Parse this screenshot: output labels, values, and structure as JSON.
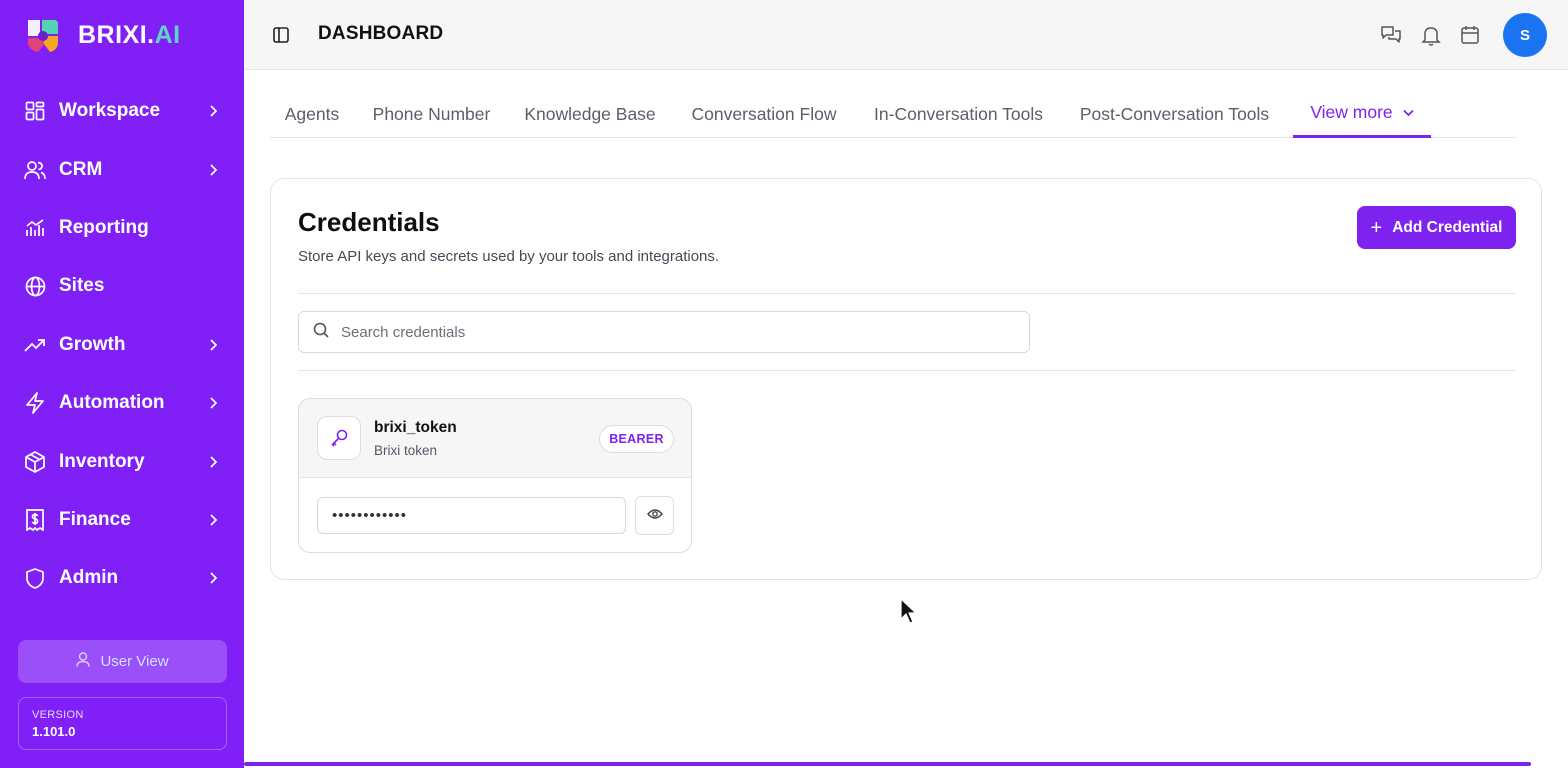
{
  "app": {
    "logo_main": "BRIXI.",
    "logo_accent": "AI"
  },
  "sidebar": {
    "items": [
      {
        "label": "Workspace",
        "icon": "grid-icon",
        "has_chevron": true
      },
      {
        "label": "CRM",
        "icon": "users-icon",
        "has_chevron": true
      },
      {
        "label": "Reporting",
        "icon": "chart-icon",
        "has_chevron": false
      },
      {
        "label": "Sites",
        "icon": "globe-icon",
        "has_chevron": false
      },
      {
        "label": "Growth",
        "icon": "trend-icon",
        "has_chevron": true
      },
      {
        "label": "Automation",
        "icon": "bolt-icon",
        "has_chevron": true
      },
      {
        "label": "Inventory",
        "icon": "box-icon",
        "has_chevron": true
      },
      {
        "label": "Finance",
        "icon": "receipt-icon",
        "has_chevron": true
      },
      {
        "label": "Admin",
        "icon": "shield-icon",
        "has_chevron": true
      }
    ],
    "user_view_label": "User View",
    "version_label": "VERSION",
    "version_number": "1.101.0"
  },
  "header": {
    "title": "DASHBOARD",
    "avatar_initial": "S"
  },
  "tabs": [
    {
      "label": "Agents",
      "active": false
    },
    {
      "label": "Phone Number",
      "active": false
    },
    {
      "label": "Knowledge Base",
      "active": false
    },
    {
      "label": "Conversation Flow",
      "active": false
    },
    {
      "label": "In-Conversation Tools",
      "active": false
    },
    {
      "label": "Post-Conversation Tools",
      "active": false
    },
    {
      "label": "View more",
      "active": true
    }
  ],
  "credentials": {
    "title": "Credentials",
    "subtitle": "Store API keys and secrets used by your tools and integrations.",
    "add_button_label": "Add Credential",
    "search_placeholder": "Search credentials",
    "items": [
      {
        "name": "brixi_token",
        "description": "Brixi token",
        "type_badge": "BEARER",
        "masked_value": "••••••••••••"
      }
    ]
  },
  "colors": {
    "brand_purple": "#8020f7",
    "accent_purple": "#7e22f0",
    "avatar_blue": "#1a73f0",
    "logo_accent": "#5fd4c6"
  }
}
